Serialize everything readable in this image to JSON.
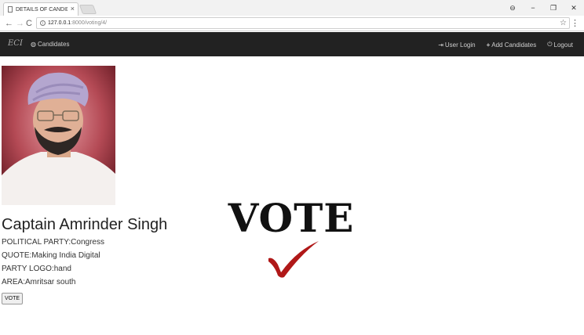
{
  "browser": {
    "tab_title": "DETAILS OF CANDIDATE",
    "tab_close": "×",
    "url_host": "127.0.0.1",
    "url_path": ":8000/voting/4/",
    "back": "←",
    "forward": "→",
    "reload": "C",
    "star": "☆",
    "menu": "⋮",
    "win_account": "⊖",
    "win_minimize": "−",
    "win_restore": "❐",
    "win_close": "✕"
  },
  "navbar": {
    "brand": "ECI",
    "candidates": "Candidates",
    "user_login": "User Login",
    "add_candidates": "Add Candidates",
    "logout": "Logout"
  },
  "candidate": {
    "name": "Captain Amrinder Singh",
    "party": "POLITICAL PARTY:Congress",
    "quote": "QUOTE:Making India Digital",
    "logo": "PARTY LOGO:hand",
    "area": "AREA:Amritsar south"
  },
  "vote_button": "VOTE",
  "vote_graphic_text": "VOTE",
  "icons": {
    "nav_candidates": "globe-icon",
    "user_login": "login-icon",
    "add_candidates": "plus-icon",
    "logout": "power-icon"
  },
  "colors": {
    "navbar_bg": "#222222",
    "checkmark": "#b01818",
    "vote_text": "#111111"
  }
}
